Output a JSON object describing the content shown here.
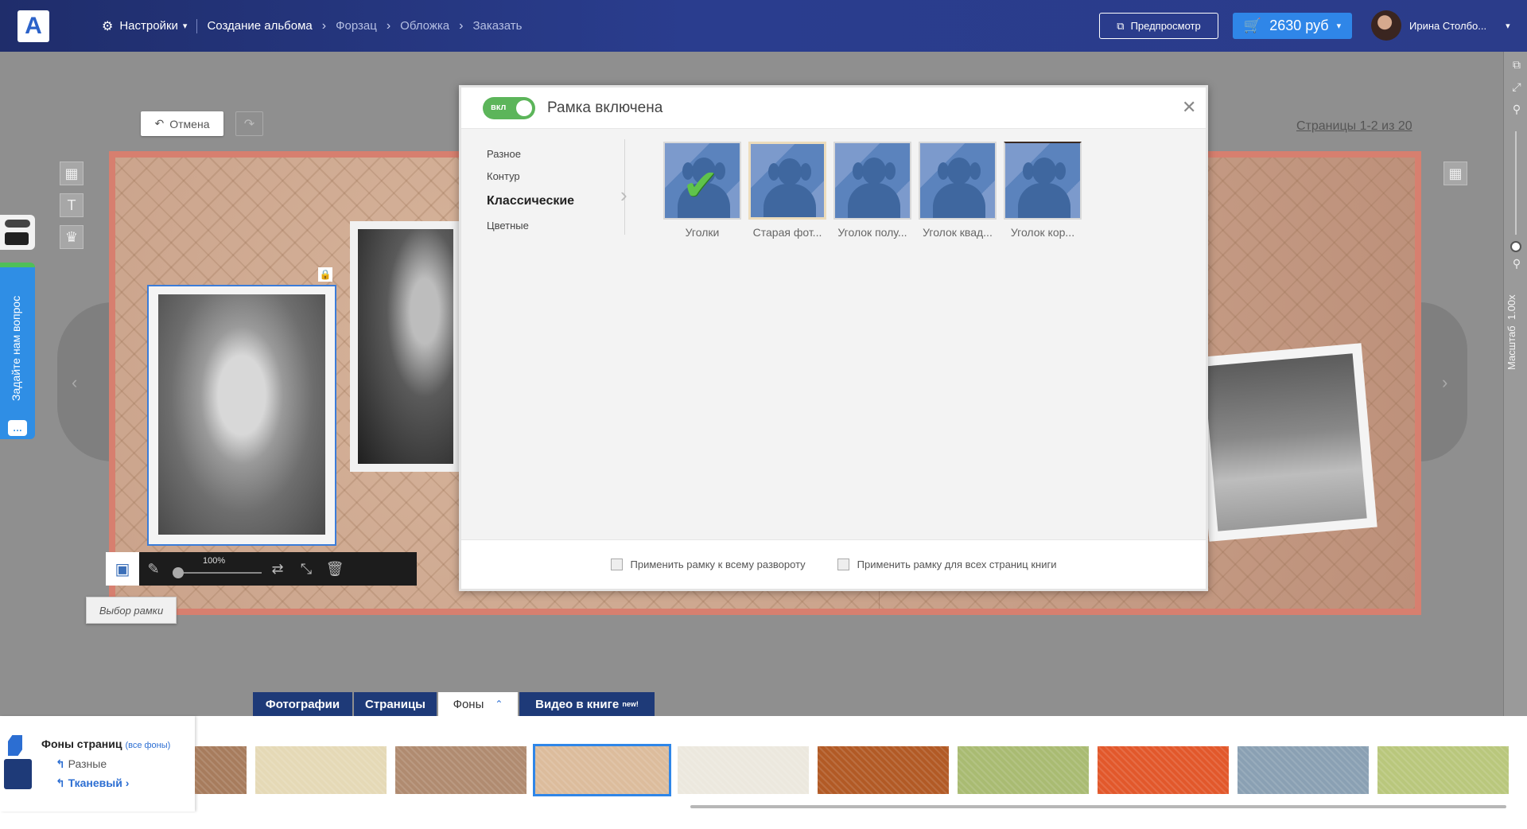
{
  "header": {
    "logo_letter": "A",
    "settings_label": "Настройки",
    "breadcrumbs": [
      "Создание альбома",
      "Форзац",
      "Обложка",
      "Заказать"
    ],
    "preview_label": "Предпросмотр",
    "cart_price": "2630 руб",
    "user_name": "Ирина Столбо..."
  },
  "workspace": {
    "undo_label": "Отмена",
    "pages_info": "Страницы 1-2 из 20",
    "zoom_value": "1.00x",
    "zoom_label": "Масштаб",
    "photo_zoom": "100%",
    "frame_tooltip": "Выбор рамки"
  },
  "ask_tab": {
    "label": "Задайте нам вопрос"
  },
  "modal": {
    "toggle_label": "вкл",
    "title": "Рамка включена",
    "categories": [
      "Разное",
      "Контур",
      "Классические",
      "Цветные"
    ],
    "active_category": "Классические",
    "frames": [
      {
        "name": "Уголки",
        "selected": true
      },
      {
        "name": "Старая фот...",
        "selected": false
      },
      {
        "name": "Уголок полу...",
        "selected": false
      },
      {
        "name": "Уголок квад...",
        "selected": false
      },
      {
        "name": "Уголок кор...",
        "selected": false
      }
    ],
    "apply_spread": "Применить рамку к всему развороту",
    "apply_all": "Применить рамку для всех страниц книги"
  },
  "tabs": [
    "Фотографии",
    "Страницы",
    "Фоны",
    "Видео в книге"
  ],
  "active_tab": "Фоны",
  "new_badge": "new!",
  "backgrounds": {
    "title": "Фоны страниц",
    "all_link": "(все фоны)",
    "parent": "Разные",
    "current": "Тканевый",
    "swatches": [
      "#a77c5d",
      "#e5d9b6",
      "#b08b70",
      "#dcbc9c",
      "#ece8de",
      "#b25a25",
      "#a9bb72",
      "#e2582b",
      "#8aa0b3",
      "#b9c77c"
    ],
    "selected_swatch_index": 3
  },
  "colors": {
    "topbar": "#2a3d8e",
    "accent": "#2f86e8",
    "toggle_on": "#5cb55a",
    "tab_dark": "#1e3a78"
  }
}
